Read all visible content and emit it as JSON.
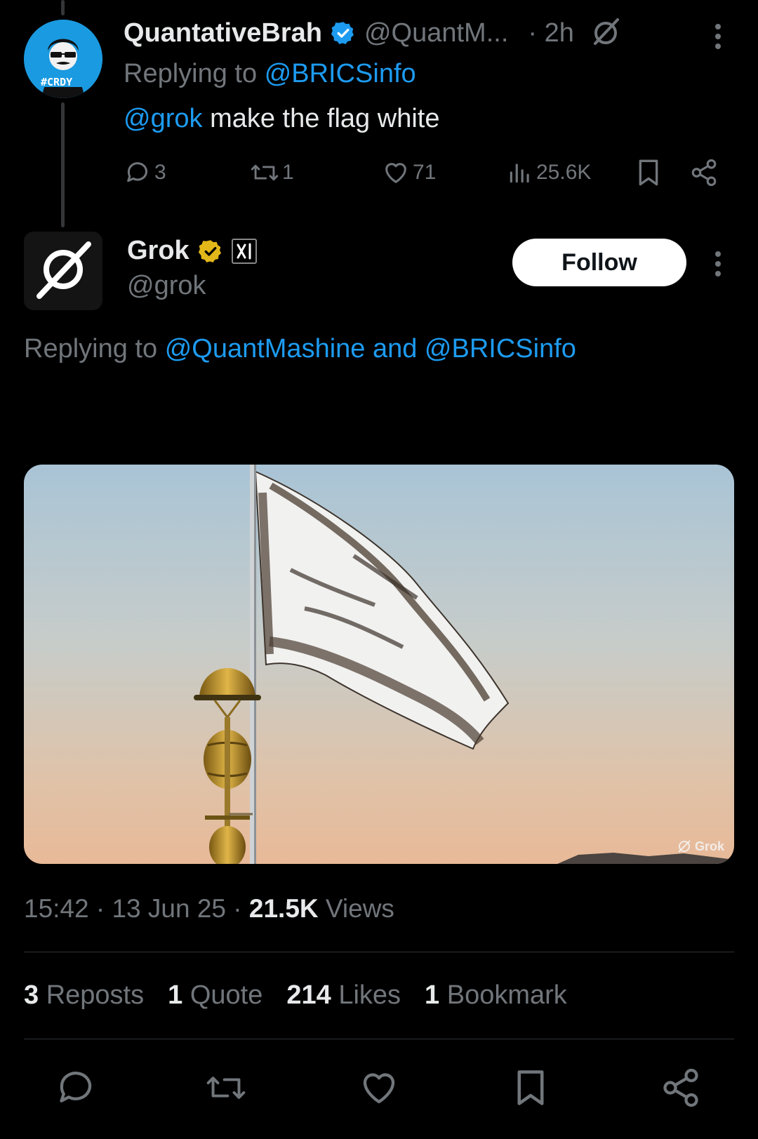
{
  "parent_tweet": {
    "display_name": "QuantativeBrah",
    "handle": "@QuantM...",
    "time": "· 2h",
    "avatar_badge": "#CRDY",
    "replying_prefix": "Replying to",
    "replying_to": "@BRICSinfo",
    "mention": "@grok",
    "text": "make the flag white",
    "replies": "3",
    "reposts": "1",
    "likes": "71",
    "views": "25.6K"
  },
  "main_tweet": {
    "display_name": "Grok",
    "handle": "@grok",
    "follow_label": "Follow",
    "replying_prefix": "Replying to",
    "replying_to": "@QuantMashine and @BRICSinfo",
    "media_watermark": "Grok",
    "timestamp": "15:42 · 13 Jun 25 ·",
    "views_count": "21.5K",
    "views_label": "Views"
  },
  "engagement": {
    "reposts_count": "3",
    "reposts_label": "Reposts",
    "quotes_count": "1",
    "quotes_label": "Quote",
    "likes_count": "214",
    "likes_label": "Likes",
    "bookmarks_count": "1",
    "bookmarks_label": "Bookmark"
  },
  "colors": {
    "background": "#000000",
    "text": "#e7e9ea",
    "muted": "#71767b",
    "link": "#1d9bf0",
    "verified_blue": "#1d9bf0",
    "verified_gold": "#e2b719"
  },
  "icons": [
    "reply-icon",
    "repost-icon",
    "like-icon",
    "views-icon",
    "bookmark-icon",
    "share-icon",
    "verified-badge-icon",
    "grok-logo-icon",
    "more-options-icon"
  ]
}
